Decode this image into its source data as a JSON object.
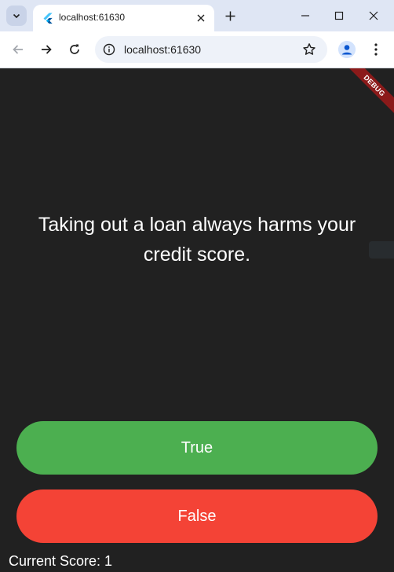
{
  "browser": {
    "tab_title": "localhost:61630",
    "url": "localhost:61630"
  },
  "app": {
    "debug_banner": "DEBUG",
    "question": "Taking out a loan always harms your credit score.",
    "buttons": {
      "true_label": "True",
      "false_label": "False"
    },
    "score_text": "Current Score: 1",
    "colors": {
      "background": "#212121",
      "true_button": "#4caf50",
      "false_button": "#f44336"
    }
  },
  "icons": {
    "tab_search": "chevron-down-icon",
    "favicon": "flutter-icon",
    "tab_close": "close-icon",
    "new_tab": "plus-icon",
    "minimize": "minimize-icon",
    "maximize": "maximize-icon",
    "close_window": "close-icon",
    "back": "arrow-left-icon",
    "forward": "arrow-right-icon",
    "reload": "reload-icon",
    "site_info": "info-icon",
    "bookmark": "star-icon",
    "profile": "person-icon",
    "menu": "kebab-menu-icon"
  }
}
